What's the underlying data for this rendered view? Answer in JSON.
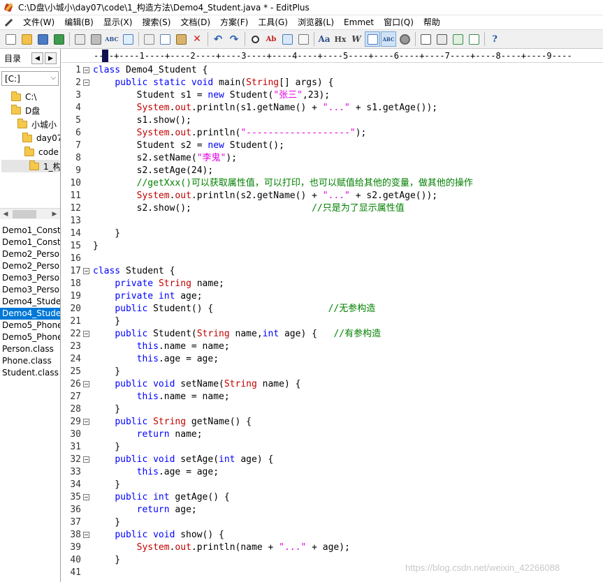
{
  "window": {
    "title": "C:\\D盘\\小城小\\day07\\code\\1_构造方法\\Demo4_Student.java * - EditPlus"
  },
  "menu": [
    {
      "label": "文件(W)"
    },
    {
      "label": "编辑(B)"
    },
    {
      "label": "显示(X)"
    },
    {
      "label": "搜索(S)"
    },
    {
      "label": "文档(D)"
    },
    {
      "label": "方案(F)"
    },
    {
      "label": "工具(G)"
    },
    {
      "label": "浏览器(L)"
    },
    {
      "label": "Emmet"
    },
    {
      "label": "窗口(Q)"
    },
    {
      "label": "帮助"
    }
  ],
  "sidebar": {
    "tab_label": "目录",
    "drive": "[C:]",
    "tree": [
      {
        "label": "C:\\"
      },
      {
        "label": "D盘"
      },
      {
        "label": "小城小"
      },
      {
        "label": "day07"
      },
      {
        "label": "code"
      },
      {
        "label": "1_构"
      }
    ],
    "files": [
      {
        "label": "Demo1_Const"
      },
      {
        "label": "Demo1_Const"
      },
      {
        "label": "Demo2_Perso"
      },
      {
        "label": "Demo2_Perso"
      },
      {
        "label": "Demo3_Perso"
      },
      {
        "label": "Demo3_Perso"
      },
      {
        "label": "Demo4_Stude"
      },
      {
        "label": "Demo4_Stude"
      },
      {
        "label": "Demo5_Phone"
      },
      {
        "label": "Demo5_Phone"
      },
      {
        "label": "Person.class"
      },
      {
        "label": "Phone.class"
      },
      {
        "label": "Student.class"
      }
    ]
  },
  "ruler": "----+----1----+----2----+----3----+----4----+----5----+----6----+----7----+----8----+----9----",
  "code_lines": [
    {
      "n": "1",
      "fold": true,
      "tokens": [
        {
          "t": "class ",
          "c": "kw"
        },
        {
          "t": "Demo4_Student {"
        }
      ]
    },
    {
      "n": "2",
      "fold": true,
      "tokens": [
        {
          "t": "    "
        },
        {
          "t": "public static void ",
          "c": "kw"
        },
        {
          "t": "main("
        },
        {
          "t": "String",
          "c": "ty"
        },
        {
          "t": "[] args) {"
        }
      ]
    },
    {
      "n": "3",
      "tokens": [
        {
          "t": "        Student s1 = "
        },
        {
          "t": "new ",
          "c": "kw"
        },
        {
          "t": "Student("
        },
        {
          "t": "\"张三\"",
          "c": "str"
        },
        {
          "t": ",23);"
        }
      ]
    },
    {
      "n": "4",
      "tokens": [
        {
          "t": "        "
        },
        {
          "t": "System",
          "c": "sys"
        },
        {
          "t": "."
        },
        {
          "t": "out",
          "c": "sys"
        },
        {
          "t": ".println(s1.getName() + "
        },
        {
          "t": "\"...\"",
          "c": "str"
        },
        {
          "t": " + s1.getAge());"
        }
      ]
    },
    {
      "n": "5",
      "tokens": [
        {
          "t": "        s1.show();"
        }
      ]
    },
    {
      "n": "6",
      "tokens": [
        {
          "t": "        "
        },
        {
          "t": "System",
          "c": "sys"
        },
        {
          "t": "."
        },
        {
          "t": "out",
          "c": "sys"
        },
        {
          "t": ".println("
        },
        {
          "t": "\"-------------------\"",
          "c": "str"
        },
        {
          "t": ");"
        }
      ]
    },
    {
      "n": "7",
      "tokens": [
        {
          "t": "        Student s2 = "
        },
        {
          "t": "new ",
          "c": "kw"
        },
        {
          "t": "Student();"
        }
      ]
    },
    {
      "n": "8",
      "tokens": [
        {
          "t": "        s2.setName("
        },
        {
          "t": "\"李鬼\"",
          "c": "str"
        },
        {
          "t": ");"
        }
      ]
    },
    {
      "n": "9",
      "tokens": [
        {
          "t": "        s2.setAge(24);"
        }
      ]
    },
    {
      "n": "10",
      "tokens": [
        {
          "t": "        "
        },
        {
          "t": "//getXxx()可以获取属性值，可以打印，也可以赋值给其他的变量，做其他的操作",
          "c": "cm"
        }
      ]
    },
    {
      "n": "11",
      "tokens": [
        {
          "t": "        "
        },
        {
          "t": "System",
          "c": "sys"
        },
        {
          "t": "."
        },
        {
          "t": "out",
          "c": "sys"
        },
        {
          "t": ".println(s2.getName() + "
        },
        {
          "t": "\"...\"",
          "c": "str"
        },
        {
          "t": " + s2.getAge());"
        }
      ]
    },
    {
      "n": "12",
      "tokens": [
        {
          "t": "        s2.show();                      "
        },
        {
          "t": "//只是为了显示属性值",
          "c": "cm"
        }
      ]
    },
    {
      "n": "13",
      "tokens": []
    },
    {
      "n": "14",
      "tokens": [
        {
          "t": "    }"
        }
      ]
    },
    {
      "n": "15",
      "tokens": [
        {
          "t": "}"
        }
      ]
    },
    {
      "n": "16",
      "tokens": []
    },
    {
      "n": "17",
      "fold": true,
      "tokens": [
        {
          "t": "class ",
          "c": "kw"
        },
        {
          "t": "Student {"
        }
      ]
    },
    {
      "n": "18",
      "tokens": [
        {
          "t": "    "
        },
        {
          "t": "private ",
          "c": "kw"
        },
        {
          "t": "String",
          "c": "ty"
        },
        {
          "t": " name;"
        }
      ]
    },
    {
      "n": "19",
      "tokens": [
        {
          "t": "    "
        },
        {
          "t": "private int ",
          "c": "kw"
        },
        {
          "t": "age;"
        }
      ]
    },
    {
      "n": "20",
      "tokens": [
        {
          "t": "    "
        },
        {
          "t": "public ",
          "c": "kw"
        },
        {
          "t": "Student() {                     "
        },
        {
          "t": "//无参构造",
          "c": "cm"
        }
      ]
    },
    {
      "n": "21",
      "tokens": [
        {
          "t": "    }"
        }
      ]
    },
    {
      "n": "22",
      "fold": true,
      "tokens": [
        {
          "t": "    "
        },
        {
          "t": "public ",
          "c": "kw"
        },
        {
          "t": "Student("
        },
        {
          "t": "String",
          "c": "ty"
        },
        {
          "t": " name,"
        },
        {
          "t": "int ",
          "c": "kw"
        },
        {
          "t": "age) {   "
        },
        {
          "t": "//有参构造",
          "c": "cm"
        }
      ]
    },
    {
      "n": "23",
      "tokens": [
        {
          "t": "        "
        },
        {
          "t": "this",
          "c": "kw"
        },
        {
          "t": ".name = name;"
        }
      ]
    },
    {
      "n": "24",
      "tokens": [
        {
          "t": "        "
        },
        {
          "t": "this",
          "c": "kw"
        },
        {
          "t": ".age = age;"
        }
      ]
    },
    {
      "n": "25",
      "tokens": [
        {
          "t": "    }"
        }
      ]
    },
    {
      "n": "26",
      "fold": true,
      "tokens": [
        {
          "t": "    "
        },
        {
          "t": "public void ",
          "c": "kw"
        },
        {
          "t": "setName("
        },
        {
          "t": "String",
          "c": "ty"
        },
        {
          "t": " name) {"
        }
      ]
    },
    {
      "n": "27",
      "tokens": [
        {
          "t": "        "
        },
        {
          "t": "this",
          "c": "kw"
        },
        {
          "t": ".name = name;"
        }
      ]
    },
    {
      "n": "28",
      "tokens": [
        {
          "t": "    }"
        }
      ]
    },
    {
      "n": "29",
      "fold": true,
      "tokens": [
        {
          "t": "    "
        },
        {
          "t": "public ",
          "c": "kw"
        },
        {
          "t": "String",
          "c": "ty"
        },
        {
          "t": " getName() {"
        }
      ]
    },
    {
      "n": "30",
      "tokens": [
        {
          "t": "        "
        },
        {
          "t": "return ",
          "c": "kw"
        },
        {
          "t": "name;"
        }
      ]
    },
    {
      "n": "31",
      "tokens": [
        {
          "t": "    }"
        }
      ]
    },
    {
      "n": "32",
      "fold": true,
      "tokens": [
        {
          "t": "    "
        },
        {
          "t": "public void ",
          "c": "kw"
        },
        {
          "t": "setAge("
        },
        {
          "t": "int ",
          "c": "kw"
        },
        {
          "t": "age) {"
        }
      ]
    },
    {
      "n": "33",
      "tokens": [
        {
          "t": "        "
        },
        {
          "t": "this",
          "c": "kw"
        },
        {
          "t": ".age = age;"
        }
      ]
    },
    {
      "n": "34",
      "tokens": [
        {
          "t": "    }"
        }
      ]
    },
    {
      "n": "35",
      "fold": true,
      "tokens": [
        {
          "t": "    "
        },
        {
          "t": "public int ",
          "c": "kw"
        },
        {
          "t": "getAge() {"
        }
      ]
    },
    {
      "n": "36",
      "tokens": [
        {
          "t": "        "
        },
        {
          "t": "return ",
          "c": "kw"
        },
        {
          "t": "age;"
        }
      ]
    },
    {
      "n": "37",
      "tokens": [
        {
          "t": "    }"
        }
      ]
    },
    {
      "n": "38",
      "fold": true,
      "tokens": [
        {
          "t": "    "
        },
        {
          "t": "public void ",
          "c": "kw"
        },
        {
          "t": "show() {"
        }
      ]
    },
    {
      "n": "39",
      "tokens": [
        {
          "t": "        "
        },
        {
          "t": "System",
          "c": "sys"
        },
        {
          "t": "."
        },
        {
          "t": "out",
          "c": "sys"
        },
        {
          "t": ".println(name + "
        },
        {
          "t": "\"...\"",
          "c": "str"
        },
        {
          "t": " + age);"
        }
      ]
    },
    {
      "n": "40",
      "tokens": [
        {
          "t": "    }"
        }
      ]
    },
    {
      "n": "41",
      "tokens": []
    }
  ],
  "watermark": "https://blog.csdn.net/weixin_42266088",
  "colors": {
    "keyword": "#0000ff",
    "type": "#c00000",
    "string": "#e000e0",
    "comment": "#008000",
    "selection": "#0078d7"
  }
}
